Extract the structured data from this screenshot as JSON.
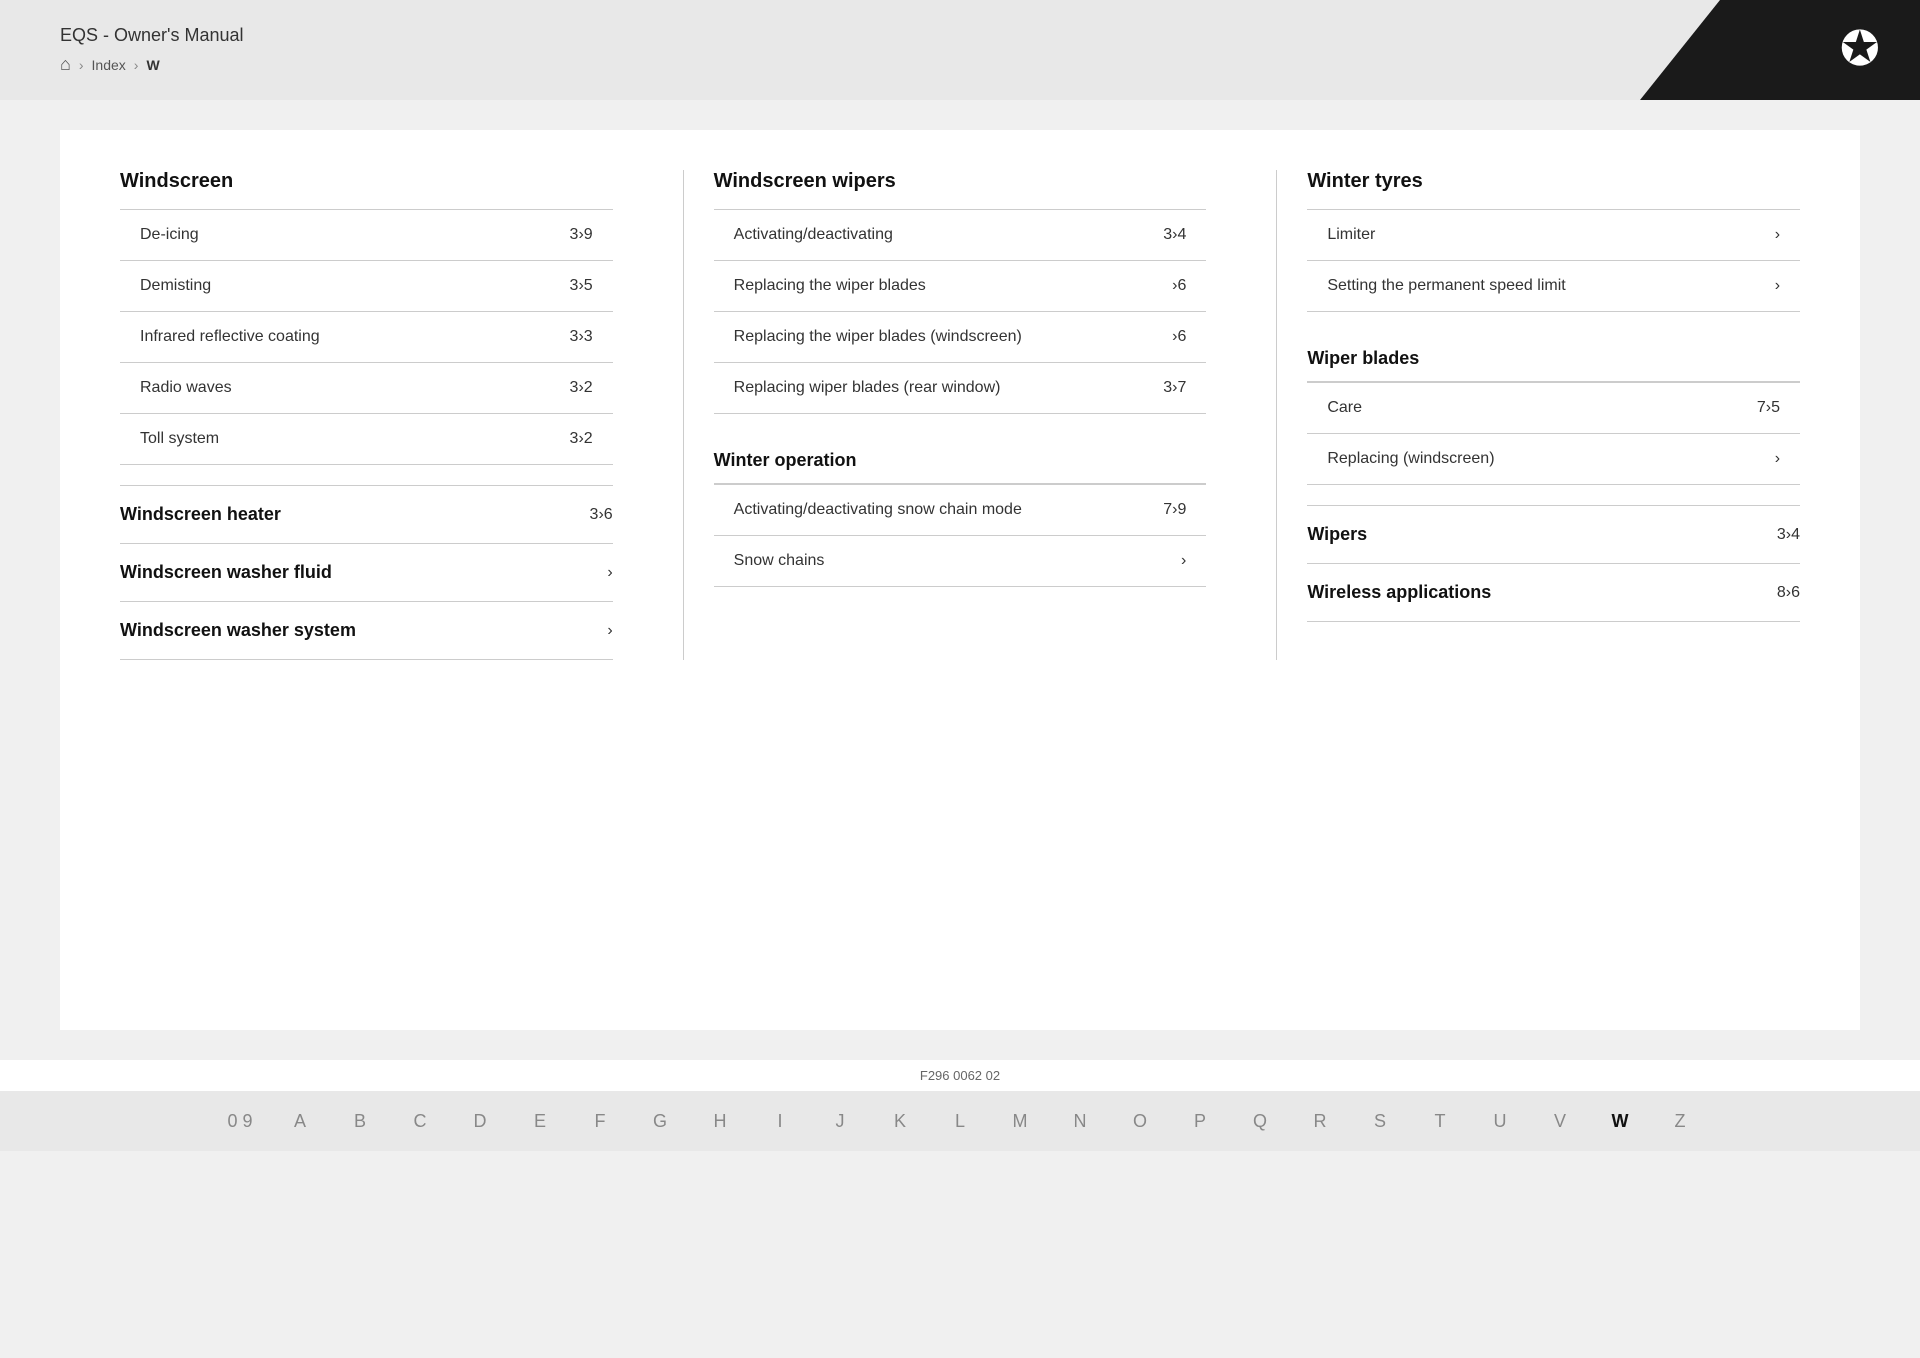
{
  "header": {
    "title": "EQS - Owner's Manual",
    "breadcrumb": {
      "home": "🏠",
      "index": "Index",
      "current": "W"
    },
    "logo_alt": "Mercedes-Benz Star"
  },
  "footer": {
    "code": "F296 0062 02",
    "alphabet": [
      "0 9",
      "A",
      "B",
      "C",
      "D",
      "E",
      "F",
      "G",
      "H",
      "I",
      "J",
      "K",
      "L",
      "M",
      "N",
      "O",
      "P",
      "Q",
      "R",
      "S",
      "T",
      "U",
      "V",
      "W",
      "Z"
    ]
  },
  "col1": {
    "title": "Windscreen",
    "items": [
      {
        "label": "De-icing",
        "page": "3›9"
      },
      {
        "label": "Demisting",
        "page": "3›5"
      },
      {
        "label": "Infrared reflective coating",
        "page": "3›3"
      },
      {
        "label": "Radio waves",
        "page": "3›2"
      },
      {
        "label": "Toll system",
        "page": "3›2"
      }
    ],
    "bold_links": [
      {
        "label": "Windscreen heater",
        "page": "3›6"
      },
      {
        "label": "Windscreen washer fluid",
        "page": "›"
      },
      {
        "label": "Windscreen washer system",
        "page": "›"
      }
    ]
  },
  "col2": {
    "title": "Windscreen wipers",
    "items": [
      {
        "label": "Activating/deactivating",
        "page": "3›4"
      },
      {
        "label": "Replacing the wiper blades",
        "page": "›6"
      },
      {
        "label": "Replacing the wiper blades (windscreen)",
        "page": "›6"
      },
      {
        "label": "Replacing wiper blades (rear window)",
        "page": "3›7"
      }
    ],
    "sub_title": "Winter operation",
    "sub_items": [
      {
        "label": "Activating/deactivating snow chain mode",
        "page": "7›9"
      },
      {
        "label": "Snow chains",
        "page": "›"
      }
    ]
  },
  "col3": {
    "title": "Winter tyres",
    "items": [
      {
        "label": "Limiter",
        "page": "›"
      },
      {
        "label": "Setting the permanent speed limit",
        "page": "›"
      }
    ],
    "sub_title1": "Wiper blades",
    "sub_items1": [
      {
        "label": "Care",
        "page": "7›5"
      },
      {
        "label": "Replacing (windscreen)",
        "page": "›"
      }
    ],
    "bold_links": [
      {
        "label": "Wipers",
        "page": "3›4"
      },
      {
        "label": "Wireless applications",
        "page": "8›6"
      }
    ]
  }
}
